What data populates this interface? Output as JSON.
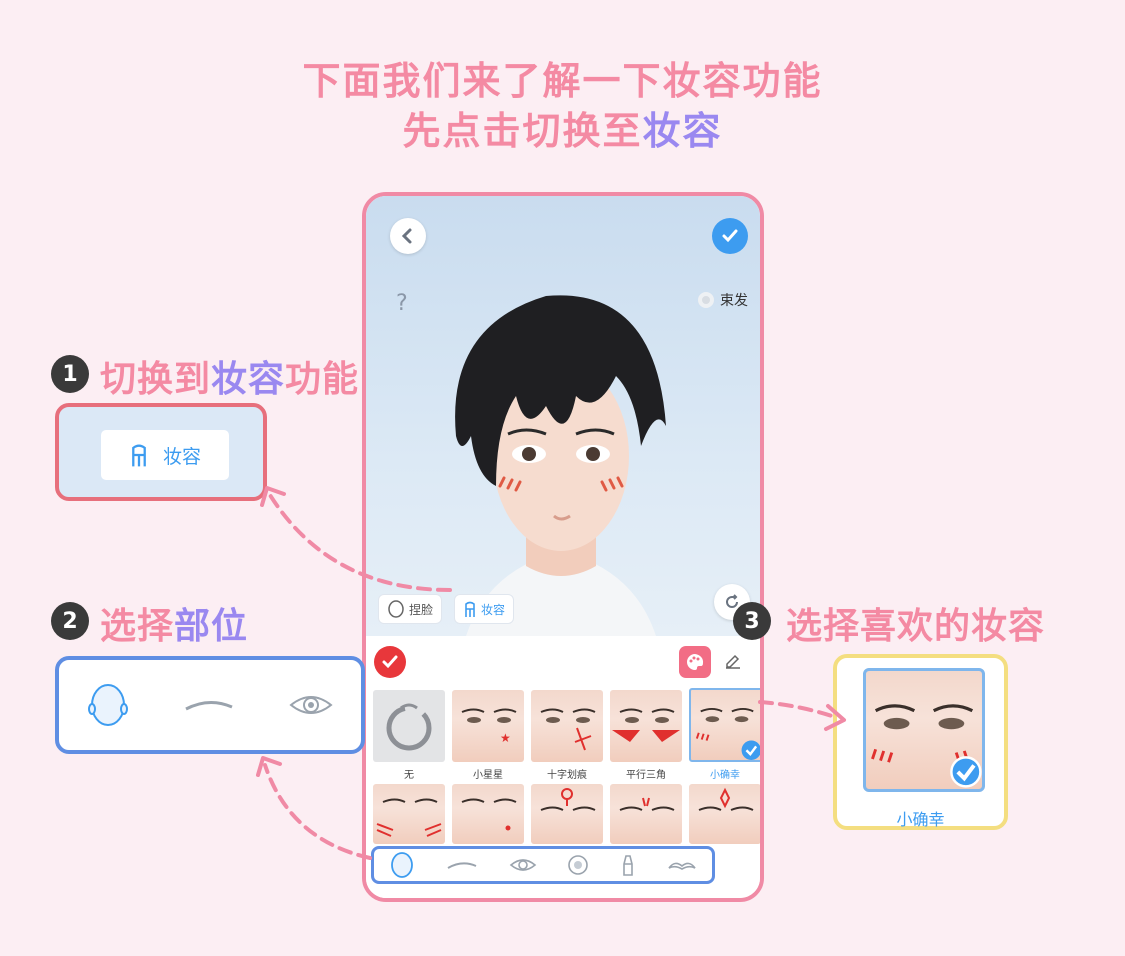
{
  "header": {
    "line1": "下面我们来了解一下妆容功能",
    "line2_prefix": "先点击切换至",
    "line2_highlight": "妆容"
  },
  "steps": [
    {
      "number": "1",
      "text_prefix": "切换到",
      "text_highlight": "妆容",
      "text_suffix": "功能"
    },
    {
      "number": "2",
      "text_prefix": "选择",
      "text_highlight": "部位",
      "text_suffix": ""
    },
    {
      "number": "3",
      "text_prefix": "选择喜欢的妆容",
      "text_highlight": "",
      "text_suffix": ""
    }
  ],
  "phone": {
    "hair_toggle_label": "束发",
    "help_icon": "?",
    "tabs": [
      {
        "label": "捏脸",
        "icon": "face-outline-icon"
      },
      {
        "label": "妆容",
        "icon": "brush-icon"
      }
    ],
    "makeup_items_row1": [
      {
        "label": "无",
        "selected": false
      },
      {
        "label": "小星星",
        "selected": false
      },
      {
        "label": "十字划痕",
        "selected": false
      },
      {
        "label": "平行三角",
        "selected": false
      },
      {
        "label": "小确幸",
        "selected": true
      }
    ],
    "part_bar_icons": [
      "face-icon",
      "eyebrow-icon",
      "eye-icon",
      "pupil-icon",
      "lipstick-icon",
      "mustache-icon"
    ]
  },
  "callout_1": {
    "chip_label": "妆容",
    "chip_icon": "brush-icon"
  },
  "callout_2": {
    "icons": [
      "face-icon",
      "eyebrow-icon",
      "eye-icon"
    ]
  },
  "callout_3": {
    "label": "小确幸"
  },
  "colors": {
    "background": "#fceef3",
    "pink": "#f48aa3",
    "purple": "#9a88f0",
    "blue": "#3d9cf0",
    "red_border": "#e76f7c",
    "blue_border": "#5f8ee3",
    "yellow_border": "#f4de80"
  }
}
